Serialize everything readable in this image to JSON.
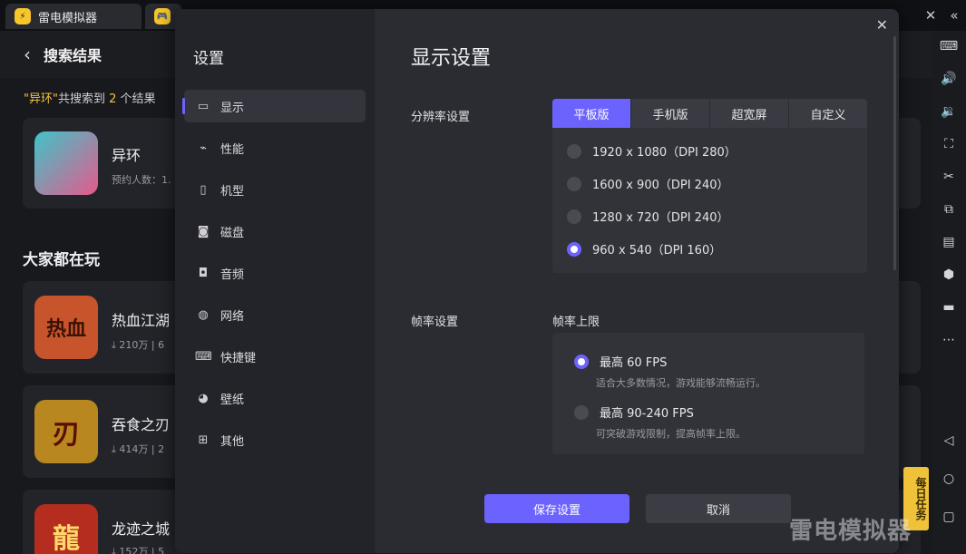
{
  "tabs": [
    {
      "label": "雷电模拟器"
    },
    {
      "label": ""
    }
  ],
  "background": {
    "back_title": "搜索结果",
    "search_count": {
      "quote_open": "\"",
      "keyword": "异环",
      "quote_close": "\"",
      "middle": "共搜索到 ",
      "count": "2",
      "suffix": " 个结果"
    },
    "top_result": {
      "name": "异环",
      "meta": "预约人数：1."
    },
    "section_title": "大家都在玩",
    "games": [
      {
        "name": "热血江湖",
        "downloads": "210万",
        "extra": "6",
        "icon_text": "热血",
        "color": "#c8542b"
      },
      {
        "name": "吞食之刃",
        "downloads": "414万",
        "extra": "2",
        "icon_text": "刃",
        "color": "#b8871f"
      },
      {
        "name": "龙迹之城",
        "downloads": "152万",
        "extra": "5",
        "icon_text": "龍",
        "color": "#b42d1f"
      }
    ]
  },
  "dialog": {
    "sidebar_title": "设置",
    "nav": [
      {
        "label": "显示",
        "icon": "monitor-icon"
      },
      {
        "label": "性能",
        "icon": "performance-icon"
      },
      {
        "label": "机型",
        "icon": "device-model-icon"
      },
      {
        "label": "磁盘",
        "icon": "disk-icon"
      },
      {
        "label": "音频",
        "icon": "audio-icon"
      },
      {
        "label": "网络",
        "icon": "network-icon"
      },
      {
        "label": "快捷键",
        "icon": "keyboard-icon"
      },
      {
        "label": "壁纸",
        "icon": "palette-icon"
      },
      {
        "label": "其他",
        "icon": "grid-icon"
      }
    ],
    "heading": "显示设置",
    "resolution": {
      "label": "分辨率设置",
      "tabs": [
        "平板版",
        "手机版",
        "超宽屏",
        "自定义"
      ],
      "options": [
        {
          "label": "1920 x 1080（DPI 280）",
          "selected": false
        },
        {
          "label": "1600 x 900（DPI 240）",
          "selected": false
        },
        {
          "label": "1280 x 720（DPI 240）",
          "selected": false
        },
        {
          "label": "960 x 540（DPI 160）",
          "selected": true
        }
      ]
    },
    "fps": {
      "label": "帧率设置",
      "sub_label": "帧率上限",
      "options": [
        {
          "label": "最高 60 FPS",
          "desc": "适合大多数情况，游戏能够流畅运行。",
          "selected": true
        },
        {
          "label": "最高 90-240 FPS",
          "desc": "可突破游戏限制，提高帧率上限。",
          "selected": false
        }
      ]
    },
    "save_label": "保存设置",
    "cancel_label": "取消"
  },
  "promo_text": "每日任务",
  "watermark": "雷电模拟器",
  "colors": {
    "accent": "#6c63ff",
    "brand_yellow": "#f5c33b"
  }
}
